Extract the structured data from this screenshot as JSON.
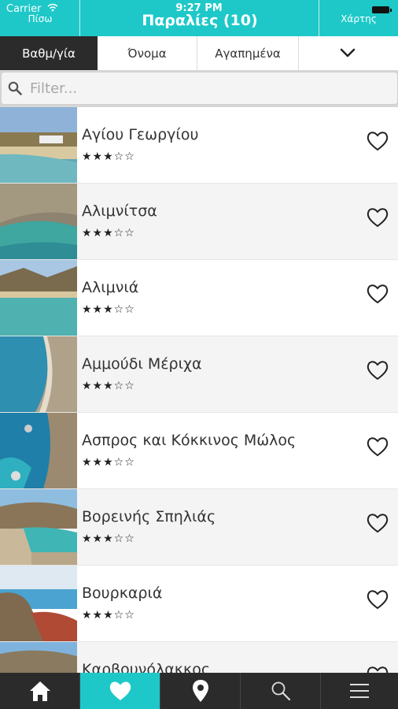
{
  "status": {
    "carrier": "Carrier",
    "time": "9:27 PM"
  },
  "header": {
    "back_label": "Πίσω",
    "title": "Παραλίες (10)",
    "map_label": "Χάρτης"
  },
  "tabs": [
    {
      "label": "Βαθμ/γία",
      "active": true
    },
    {
      "label": "Όνομα",
      "active": false
    },
    {
      "label": "Αγαπημένα",
      "active": false
    }
  ],
  "filter": {
    "placeholder": "Filter..."
  },
  "beaches": [
    {
      "name": "Αγίου Γεωργίου",
      "stars": "★★★☆☆"
    },
    {
      "name": "Αλιμνίτσα",
      "stars": "★★★☆☆"
    },
    {
      "name": "Αλιμνιά",
      "stars": "★★★☆☆"
    },
    {
      "name": "Αμμούδι Μέριχα",
      "stars": "★★★☆☆"
    },
    {
      "name": "Ασπρος και Κόκκινος Μώλος",
      "stars": "★★★☆☆"
    },
    {
      "name": "Βορεινής Σπηλιάς",
      "stars": "★★★☆☆"
    },
    {
      "name": "Βουρκαριά",
      "stars": "★★★☆☆"
    },
    {
      "name": "Καρβουνόλακκος",
      "stars": ""
    }
  ],
  "nav": [
    "home-icon",
    "heart-icon",
    "map-pin-icon",
    "search-icon",
    "menu-icon"
  ],
  "colors": {
    "accent": "#1ec8c8",
    "dark": "#2b2b2b"
  }
}
